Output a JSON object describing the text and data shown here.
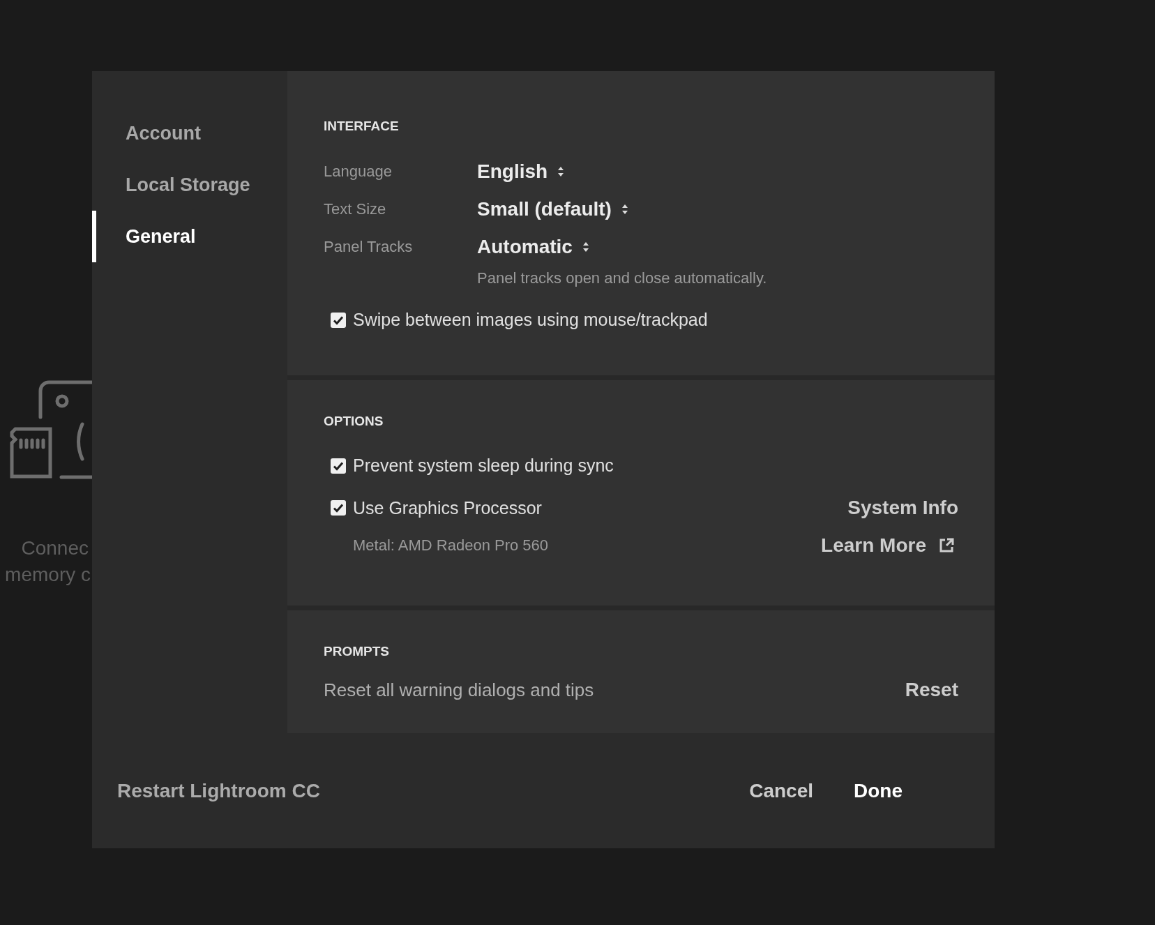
{
  "background": {
    "prompt_lines": [
      "Connec",
      "memory c"
    ]
  },
  "sidebar": {
    "items": [
      {
        "label": "Account",
        "selected": false
      },
      {
        "label": "Local Storage",
        "selected": false
      },
      {
        "label": "General",
        "selected": true
      }
    ]
  },
  "interface": {
    "heading": "INTERFACE",
    "settings": [
      {
        "label": "Language",
        "value": "English"
      },
      {
        "label": "Text Size",
        "value": "Small (default)"
      },
      {
        "label": "Panel Tracks",
        "value": "Automatic",
        "hint": "Panel tracks open and close automatically."
      }
    ],
    "swipe": {
      "label": "Swipe between images using mouse/trackpad",
      "checked": true
    }
  },
  "options": {
    "heading": "OPTIONS",
    "items": [
      {
        "label": "Prevent system sleep during sync",
        "checked": true
      },
      {
        "label": "Use Graphics Processor",
        "checked": true,
        "detail": "Metal: AMD Radeon Pro 560"
      }
    ],
    "system_info": "System Info",
    "learn_more": "Learn More"
  },
  "prompts": {
    "heading": "PROMPTS",
    "description": "Reset all warning dialogs and tips",
    "reset": "Reset"
  },
  "footer": {
    "restart": "Restart Lightroom CC",
    "cancel": "Cancel",
    "done": "Done"
  }
}
